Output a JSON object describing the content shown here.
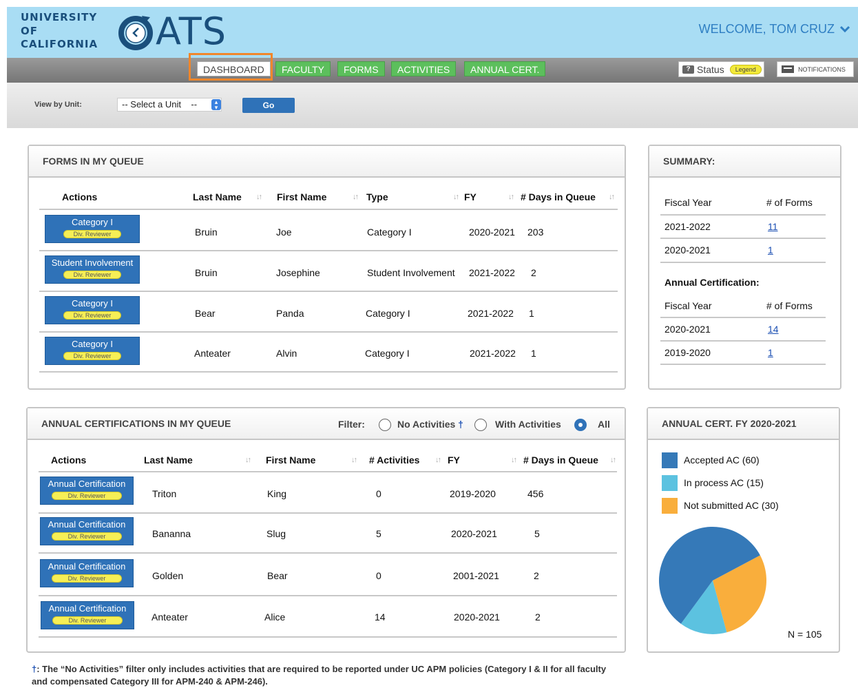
{
  "header": {
    "uc_logo_lines": [
      "UNIVERSITY",
      "OF",
      "CALIFORNIA"
    ],
    "app_logo_text": "ATS",
    "welcome": "WELCOME, TOM CRUZ",
    "welcome_icon": "chevron-down-icon",
    "colors": {
      "header_bg": "#a9ddf4",
      "logo": "#1a4f7c",
      "welcome": "#2f7fc3"
    }
  },
  "nav": {
    "tabs": [
      "DASHBOARD",
      "FACULTY",
      "FORMS",
      "ACTIVITIES",
      "ANNUAL CERT."
    ],
    "active_tab": "DASHBOARD",
    "status_label": "Status",
    "legend_label": "Legend",
    "notifications_label": "NOTIFICATIONS",
    "colors": {
      "tab": "#5cbf5c",
      "highlight": "#f0862b"
    }
  },
  "unit_filter": {
    "label": "View by Unit:",
    "select_value": "-- Select a Unit    --",
    "go_label": "Go"
  },
  "forms_queue": {
    "title": "FORMS IN MY QUEUE",
    "columns": [
      "Actions",
      "Last Name",
      "First Name",
      "Type",
      "FY",
      "# Days in Queue"
    ],
    "rows": [
      {
        "action": "Category I",
        "role": "Div. Reviewer",
        "last": "Bruin",
        "first": "Joe",
        "type": "Category I",
        "fy": "2020-2021",
        "days": "203"
      },
      {
        "action": "Student Involvement",
        "role": "Div. Reviewer",
        "last": "Bruin",
        "first": "Josephine",
        "type": "Student Involvement",
        "fy": "2021-2022",
        "days": "2"
      },
      {
        "action": "Category I",
        "role": "Div. Reviewer",
        "last": "Bear",
        "first": "Panda",
        "type": "Category I",
        "fy": "2021-2022",
        "days": "1"
      },
      {
        "action": "Category I",
        "role": "Div. Reviewer",
        "last": "Anteater",
        "first": "Alvin",
        "type": "Category I",
        "fy": "2021-2022",
        "days": "1"
      }
    ]
  },
  "summary": {
    "title": "SUMMARY:",
    "columns": [
      "Fiscal Year",
      "# of Forms"
    ],
    "rows": [
      {
        "fy": "2021-2022",
        "count": "11"
      },
      {
        "fy": "2020-2021",
        "count": "1"
      }
    ],
    "annual_title": "Annual Certification:",
    "annual_columns": [
      "Fiscal Year",
      "# of Forms"
    ],
    "annual_rows": [
      {
        "fy": "2020-2021",
        "count": "14"
      },
      {
        "fy": "2019-2020",
        "count": "1"
      }
    ]
  },
  "annual_queue": {
    "title": "ANNUAL CERTIFICATIONS IN MY QUEUE",
    "filter_label": "Filter:",
    "filter_options": [
      "No Activities",
      "With Activities",
      "All"
    ],
    "filter_selected": "All",
    "dagger": "†",
    "columns": [
      "Actions",
      "Last Name",
      "First Name",
      "# Activities",
      "FY",
      "# Days in Queue"
    ],
    "rows": [
      {
        "action": "Annual Certification",
        "role": "Div. Reviewer",
        "last": "Triton",
        "first": "King",
        "activities": "0",
        "fy": "2019-2020",
        "days": "456"
      },
      {
        "action": "Annual Certification",
        "role": "Div. Reviewer",
        "last": "Bananna",
        "first": "Slug",
        "activities": "5",
        "fy": "2020-2021",
        "days": "5"
      },
      {
        "action": "Annual Certification",
        "role": "Div. Reviewer",
        "last": "Golden",
        "first": "Bear",
        "activities": "0",
        "fy": "2001-2021",
        "days": "2"
      },
      {
        "action": "Annual Certification",
        "role": "Div. Reviewer",
        "last": "Anteater",
        "first": "Alice",
        "activities": "14",
        "fy": "2020-2021",
        "days": "2"
      }
    ]
  },
  "chart_panel": {
    "title": "ANNUAL CERT. FY 2020-2021",
    "total_label": "N = 105"
  },
  "chart_data": {
    "type": "pie",
    "title": "ANNUAL CERT. FY 2020-2021",
    "slices": [
      {
        "name": "Accepted AC",
        "value": 60,
        "label": "Accepted AC  (60)",
        "color": "#3579b8"
      },
      {
        "name": "In process AC",
        "value": 15,
        "label": "In process AC  (15)",
        "color": "#5cc2e0"
      },
      {
        "name": "Not submitted AC",
        "value": 30,
        "label": "Not submitted AC  (30)",
        "color": "#f9ae3c"
      }
    ],
    "total": 105,
    "legend_position": "top"
  },
  "footnote": {
    "symbol": "†",
    "text": ": The “No Activities” filter only includes activities that are required to be reported under UC APM policies (Category I & II for all faculty and compensated Category III for APM-240 & APM-246)."
  }
}
